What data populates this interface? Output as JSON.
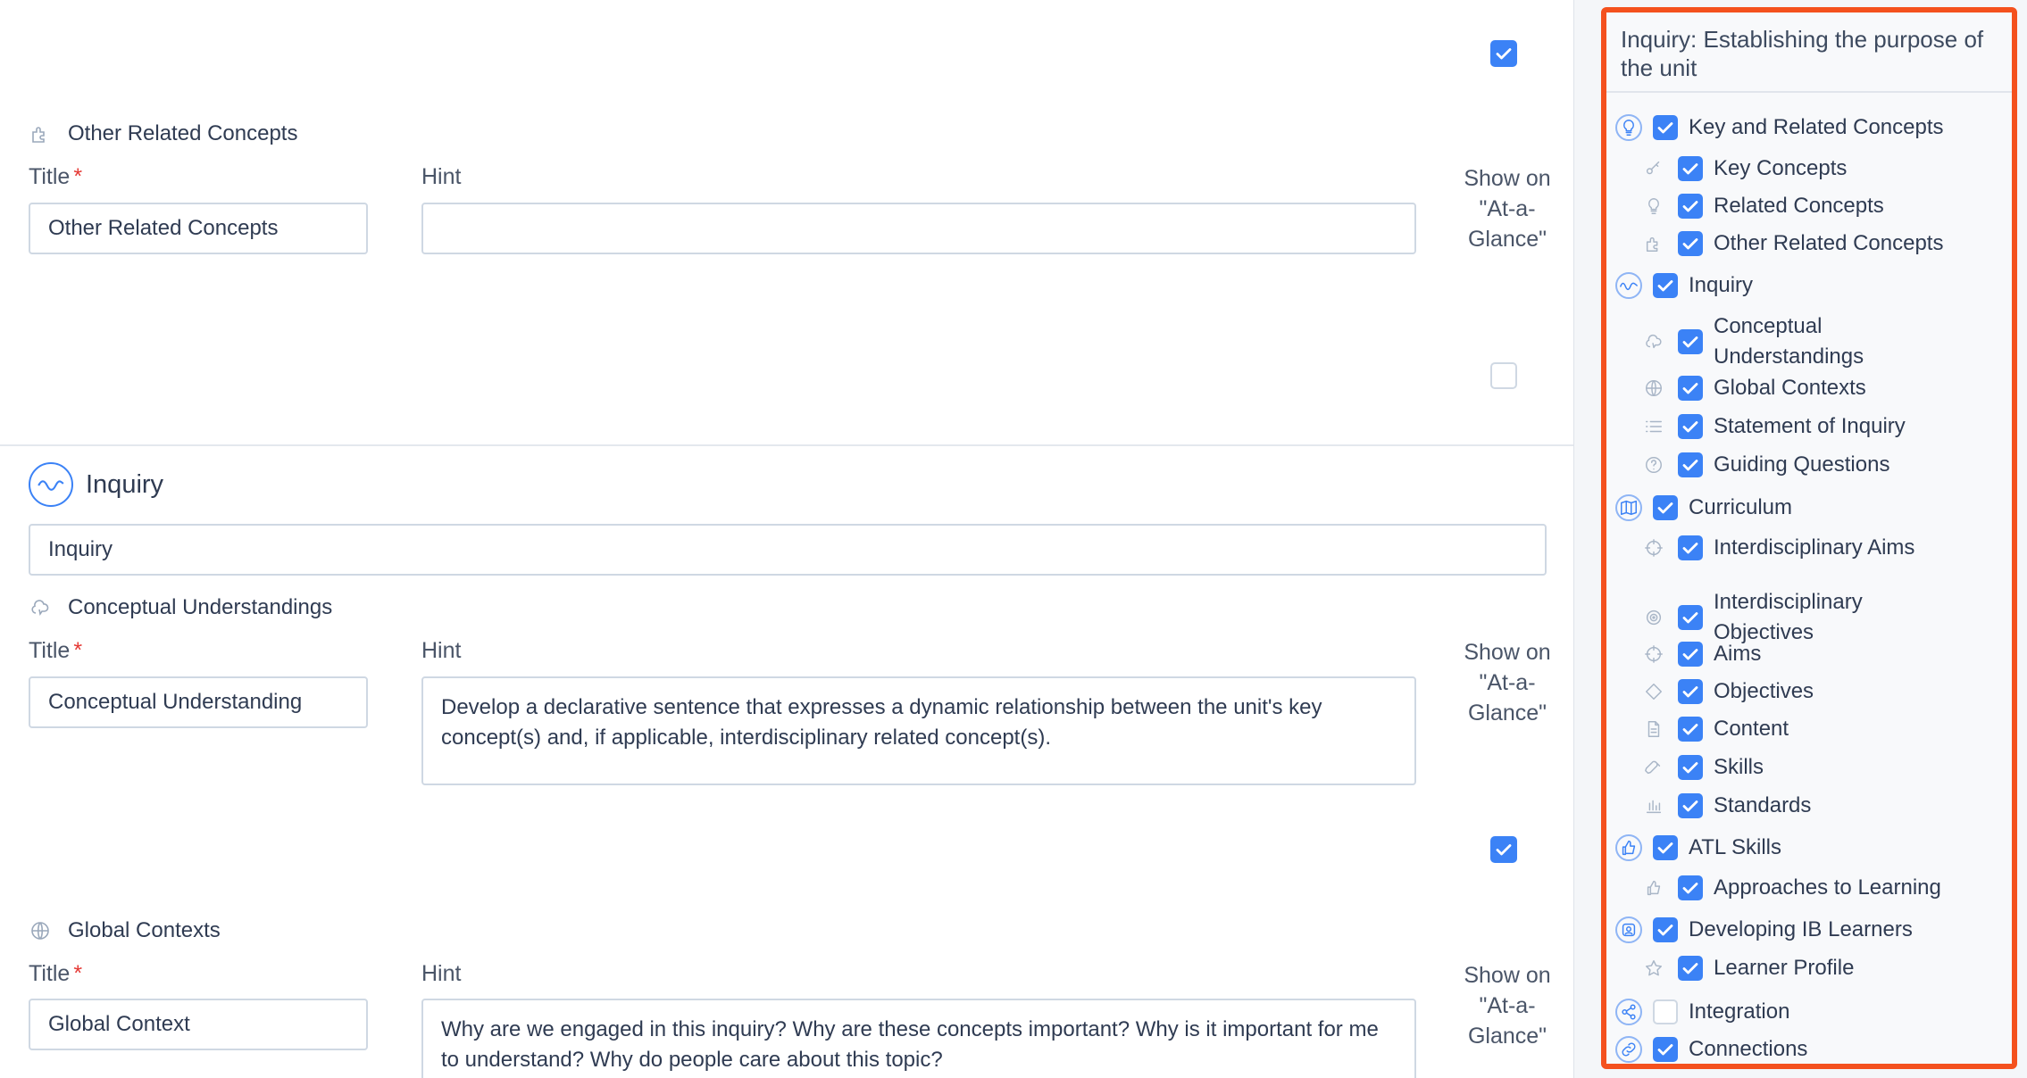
{
  "main": {
    "other_related": {
      "heading": "Other Related Concepts",
      "title_label": "Title",
      "title_value": "Other Related Concepts",
      "hint_label": "Hint",
      "hint_value": "",
      "show_label": "Show on \"At-a-Glance\"",
      "show_checked": false
    },
    "top_checkbox_checked": true,
    "inquiry": {
      "heading": "Inquiry",
      "name_value": "Inquiry"
    },
    "conceptual": {
      "heading": "Conceptual Understandings",
      "title_label": "Title",
      "title_value": "Conceptual Understanding",
      "hint_label": "Hint",
      "hint_value": "Develop a declarative sentence that expresses a dynamic relationship between the unit's key concept(s) and, if applicable, interdisciplinary related concept(s).",
      "show_label": "Show on \"At-a-Glance\"",
      "show_checked": true
    },
    "global": {
      "heading": "Global Contexts",
      "title_label": "Title",
      "title_value": "Global Context",
      "hint_label": "Hint",
      "hint_value": "Why are we engaged in this inquiry? Why are these concepts important? Why is it important for me to understand? Why do people care about this topic?",
      "show_label": "Show on \"At-a-Glance\""
    },
    "required_mark": "*"
  },
  "sidebar": {
    "title": "Inquiry: Establishing the purpose of the unit",
    "items": [
      {
        "label": "Key and Related Concepts",
        "level": 0,
        "icon": "lightbulb-icon",
        "checked": true
      },
      {
        "label": "Key Concepts",
        "level": 1,
        "icon": "key-icon",
        "checked": true
      },
      {
        "label": "Related Concepts",
        "level": 1,
        "icon": "lightbulb-icon",
        "checked": true
      },
      {
        "label": "Other Related Concepts",
        "level": 1,
        "icon": "puzzle-icon",
        "checked": true
      },
      {
        "label": "Inquiry",
        "level": 0,
        "icon": "wave-icon",
        "checked": true
      },
      {
        "label": "Conceptual Understandings",
        "level": 1,
        "icon": "brain-icon",
        "checked": true
      },
      {
        "label": "Global Contexts",
        "level": 1,
        "icon": "globe-icon",
        "checked": true
      },
      {
        "label": "Statement of Inquiry",
        "level": 1,
        "icon": "list-icon",
        "checked": true
      },
      {
        "label": "Guiding Questions",
        "level": 1,
        "icon": "question-icon",
        "checked": true
      },
      {
        "label": "Curriculum",
        "level": 0,
        "icon": "map-icon",
        "checked": true
      },
      {
        "label": "Interdisciplinary Aims",
        "level": 1,
        "icon": "crosshair-icon",
        "checked": true
      },
      {
        "label": "Interdisciplinary Objectives",
        "level": 1,
        "icon": "target-icon",
        "checked": true
      },
      {
        "label": "Aims",
        "level": 1,
        "icon": "crosshair-icon",
        "checked": true
      },
      {
        "label": "Objectives",
        "level": 1,
        "icon": "diamond-icon",
        "checked": true
      },
      {
        "label": "Content",
        "level": 1,
        "icon": "document-icon",
        "checked": true
      },
      {
        "label": "Skills",
        "level": 1,
        "icon": "rocket-icon",
        "checked": true
      },
      {
        "label": "Standards",
        "level": 1,
        "icon": "bar-chart-icon",
        "checked": true
      },
      {
        "label": "ATL Skills",
        "level": 0,
        "icon": "thumbs-icon",
        "checked": true
      },
      {
        "label": "Approaches to Learning",
        "level": 1,
        "icon": "thumbs-icon",
        "checked": true
      },
      {
        "label": "Developing IB Learners",
        "level": 0,
        "icon": "badge-icon",
        "checked": true
      },
      {
        "label": "Learner Profile",
        "level": 1,
        "icon": "star-icon",
        "checked": true
      },
      {
        "label": "Integration",
        "level": 0,
        "icon": "share-icon",
        "checked": false
      },
      {
        "label": "Connections",
        "level": 0,
        "icon": "link-icon",
        "checked": true
      }
    ]
  },
  "colors": {
    "accent": "#3b82f6",
    "highlight_border": "#f4511e",
    "required": "#e53935"
  }
}
